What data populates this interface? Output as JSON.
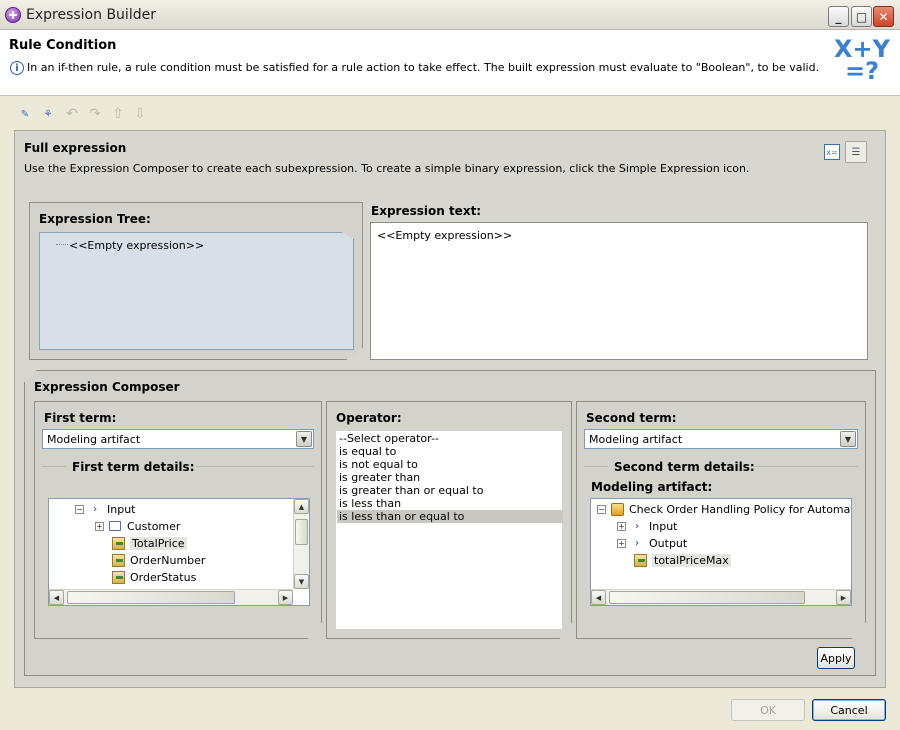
{
  "window": {
    "title": "Expression Builder"
  },
  "header": {
    "title": "Rule Condition",
    "description": "In an if-then rule, a rule condition must be satisfied for a rule action to take effect. The built expression must evaluate to \"Boolean\", to be valid.",
    "logo_top": "X+Y",
    "logo_bottom": "=?"
  },
  "full_expression": {
    "title": "Full expression",
    "description": "Use the Expression Composer to create each subexpression. To create a simple binary expression, click the Simple Expression icon."
  },
  "expression_tree": {
    "label": "Expression Tree:",
    "empty": "<<Empty expression>>"
  },
  "expression_text": {
    "label": "Expression text:",
    "value": "<<Empty expression>>"
  },
  "composer": {
    "label": "Expression Composer",
    "first_term": {
      "label": "First term:",
      "selected": "Modeling artifact",
      "details_label": "First term details:",
      "tree": [
        "Input",
        "Customer",
        "TotalPrice",
        "OrderNumber",
        "OrderStatus"
      ]
    },
    "operator": {
      "label": "Operator:",
      "options": [
        "--Select operator--",
        "is equal to",
        "is not equal to",
        "is greater than",
        "is greater than or equal to",
        "is less than",
        "is less than or equal to"
      ],
      "selected_index": 6
    },
    "second_term": {
      "label": "Second term:",
      "selected": "Modeling artifact",
      "details_label": "Second term details:",
      "modeling_label": "Modeling artifact:",
      "tree": [
        "Check Order Handling Policy for Automatic Ap",
        "Input",
        "Output",
        "totalPriceMax"
      ]
    },
    "apply_label": "Apply"
  },
  "buttons": {
    "ok": "OK",
    "cancel": "Cancel"
  }
}
